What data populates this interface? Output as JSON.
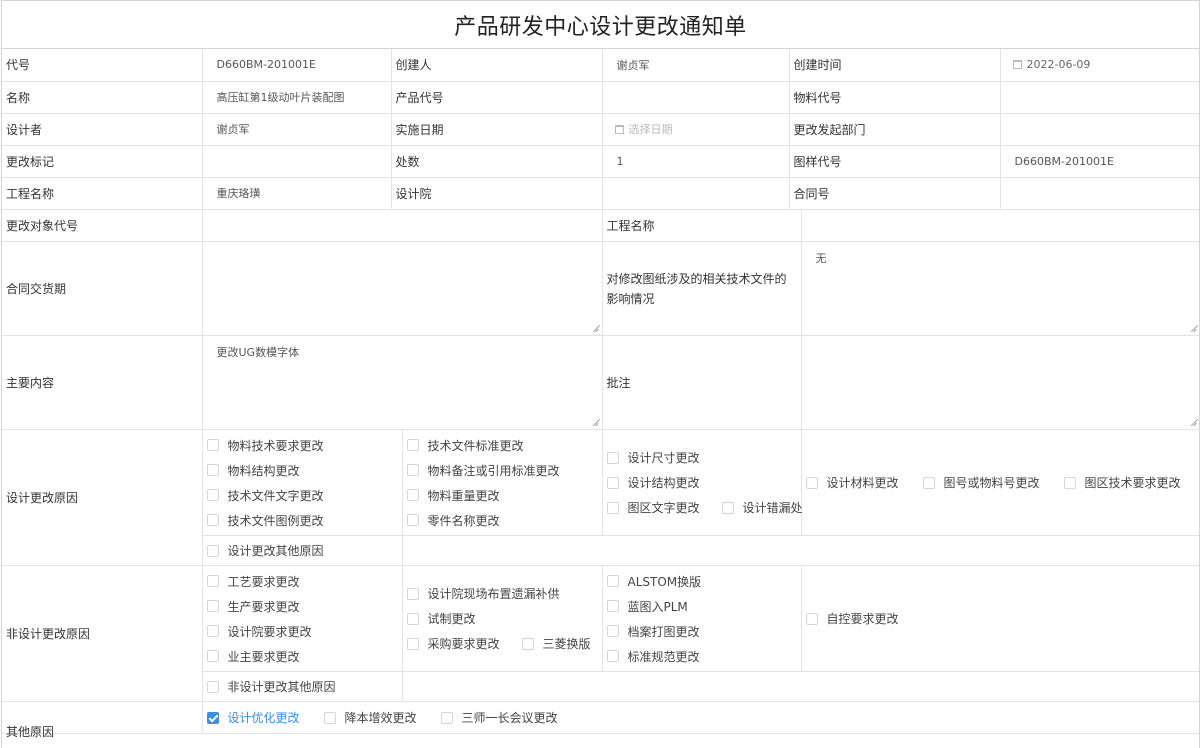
{
  "title": "产品研发中心设计更改通知单",
  "rows": {
    "code": {
      "label": "代号",
      "value": "D660BM-201001E"
    },
    "creator": {
      "label": "创建人",
      "value": "谢贞军"
    },
    "created_time": {
      "label": "创建时间",
      "value": "2022-06-09"
    },
    "name": {
      "label": "名称",
      "value": "高压缸第1级动叶片装配图"
    },
    "product_code": {
      "label": "产品代号",
      "value": ""
    },
    "material_code": {
      "label": "物料代号",
      "value": ""
    },
    "designer": {
      "label": "设计者",
      "value": "谢贞军"
    },
    "impl_date": {
      "label": "实施日期",
      "placeholder": "选择日期"
    },
    "dept": {
      "label": "更改发起部门",
      "value": ""
    },
    "change_mark": {
      "label": "更改标记",
      "value": ""
    },
    "count": {
      "label": "处数",
      "value": "1"
    },
    "drawing_code": {
      "label": "图样代号",
      "value": "D660BM-201001E"
    },
    "project_name": {
      "label": "工程名称",
      "value": "重庆珞璜"
    },
    "design_institute": {
      "label": "设计院",
      "value": ""
    },
    "contract_no": {
      "label": "合同号",
      "value": ""
    },
    "target_code": {
      "label": "更改对象代号",
      "value": ""
    },
    "project_name2": {
      "label": "工程名称",
      "value": ""
    },
    "delivery": {
      "label": "合同交货期",
      "value": ""
    },
    "impact": {
      "label": "对修改图纸涉及的相关技术文件的影响情况",
      "value": "无"
    },
    "main_content": {
      "label": "主要内容",
      "value": "更改UG数模字体"
    },
    "remark": {
      "label": "批注",
      "value": ""
    }
  },
  "design_reasons": {
    "label": "设计更改原因",
    "col1": [
      "物料技术要求更改",
      "物料结构更改",
      "技术文件文字更改",
      "技术文件图例更改"
    ],
    "col2": [
      "技术文件标准更改",
      "物料备注或引用标准更改",
      "物料重量更改",
      "零件名称更改"
    ],
    "col3": [
      "设计尺寸更改",
      "设计结构更改"
    ],
    "col3_row": [
      "图区文字更改",
      "设计错漏处"
    ],
    "col4": [
      "设计材料更改",
      "图号或物料号更改",
      "图区技术要求更改"
    ],
    "other": "设计更改其他原因"
  },
  "non_design_reasons": {
    "label": "非设计更改原因",
    "col1": [
      "工艺要求更改",
      "生产要求更改",
      "设计院要求更改",
      "业主要求更改"
    ],
    "col2": [
      "设计院现场布置遗漏补供",
      "试制更改"
    ],
    "col2_row": [
      "采购要求更改",
      "三菱换版"
    ],
    "col3": [
      "ALSTOM换版",
      "蓝图入PLM",
      "档案打图更改",
      "标准规范更改"
    ],
    "col4": [
      "自控要求更改"
    ],
    "other": "非设计更改其他原因"
  },
  "other_reasons": {
    "label": "其他原因",
    "items": [
      {
        "label": "设计优化更改",
        "checked": true
      },
      {
        "label": "降本增效更改",
        "checked": false
      },
      {
        "label": "三师一长会议更改",
        "checked": false
      }
    ]
  },
  "colors": {
    "accent": "#3a8ee6",
    "border": "#e4e4e4"
  }
}
